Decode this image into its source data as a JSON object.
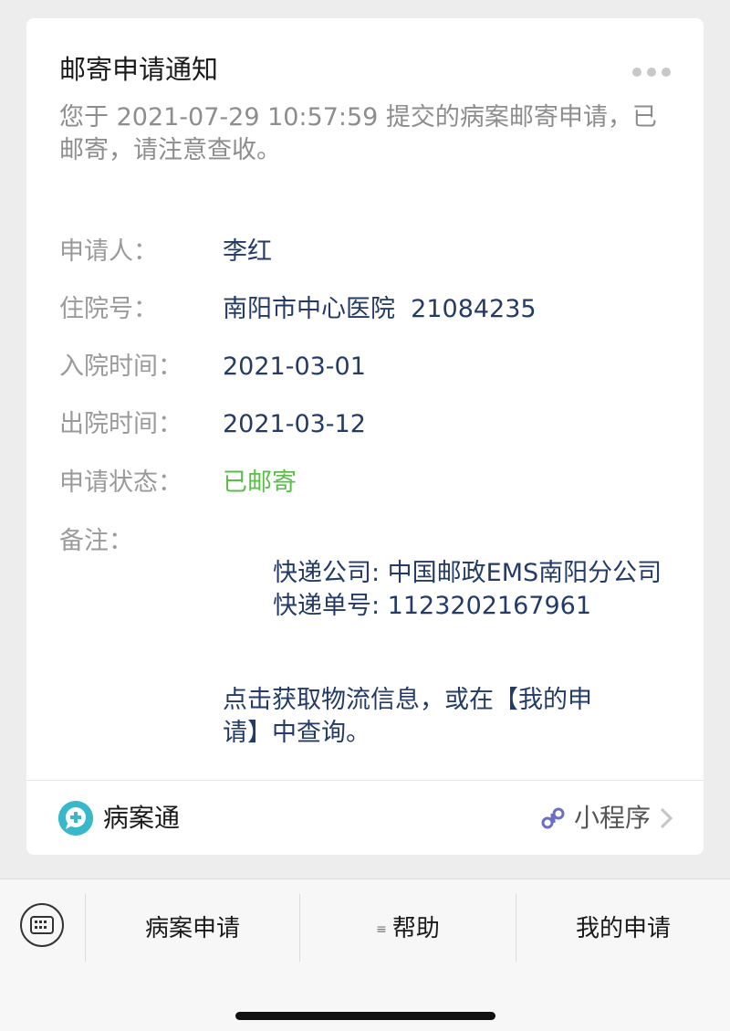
{
  "card": {
    "title": "邮寄申请通知",
    "summary": "您于 2021-07-29 10:57:59 提交的病案邮寄申请，已邮寄，请注意查收。",
    "fields": [
      {
        "label": "申请人：",
        "value": "李红"
      },
      {
        "label": "住院号：",
        "value": "南阳市中心医院  21084235"
      },
      {
        "label": "入院时间：",
        "value": "2021-03-01"
      },
      {
        "label": "出院时间：",
        "value": "2021-03-12"
      },
      {
        "label": "申请状态：",
        "value": "已邮寄"
      }
    ],
    "remark_label": "备注：",
    "remark_company": "快递公司: 中国邮政EMS南阳分公司",
    "remark_tracking": "快递单号: 1123202167961",
    "link_hint": "点击获取物流信息，或在【我的申请】中查询。",
    "app_name": "病案通",
    "mini_program_label": "小程序"
  },
  "colors": {
    "status_green": "#5bbe4a",
    "value_navy": "#233b66",
    "app_teal": "#39b8c9",
    "mini_icon_purple": "#6b6fc4"
  },
  "menu": {
    "items": [
      "病案申请",
      "帮助",
      "我的申请"
    ]
  },
  "icons": {
    "more": "more-dots-icon",
    "app": "plus-chat-icon",
    "mini": "mini-program-icon",
    "chevron": "chevron-right-icon",
    "keyboard": "keyboard-icon",
    "menu": "menu-lines-icon"
  }
}
